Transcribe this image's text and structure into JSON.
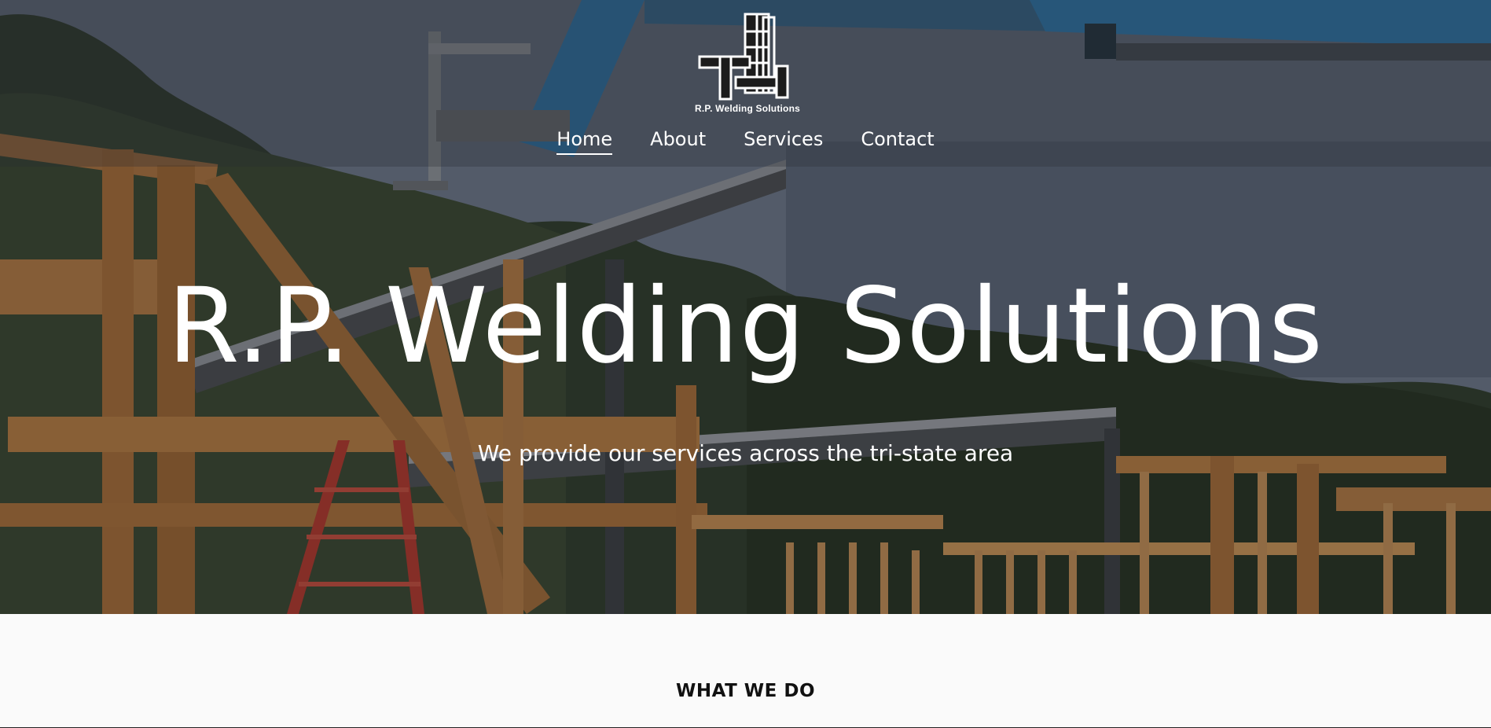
{
  "logo": {
    "caption": "R.P. Welding Solutions"
  },
  "nav": {
    "items": [
      {
        "label": "Home",
        "active": true
      },
      {
        "label": "About",
        "active": false
      },
      {
        "label": "Services",
        "active": false
      },
      {
        "label": "Contact",
        "active": false
      }
    ]
  },
  "hero": {
    "title": "R.P. Welding Solutions",
    "subtitle": "We provide our services across the tri-state area"
  },
  "section": {
    "heading": "WHAT WE DO"
  },
  "colors": {
    "text_light": "#ffffff",
    "lift_blue": "#2f7fb8",
    "wood": "#b9783e",
    "page_bg": "#fafafa"
  }
}
